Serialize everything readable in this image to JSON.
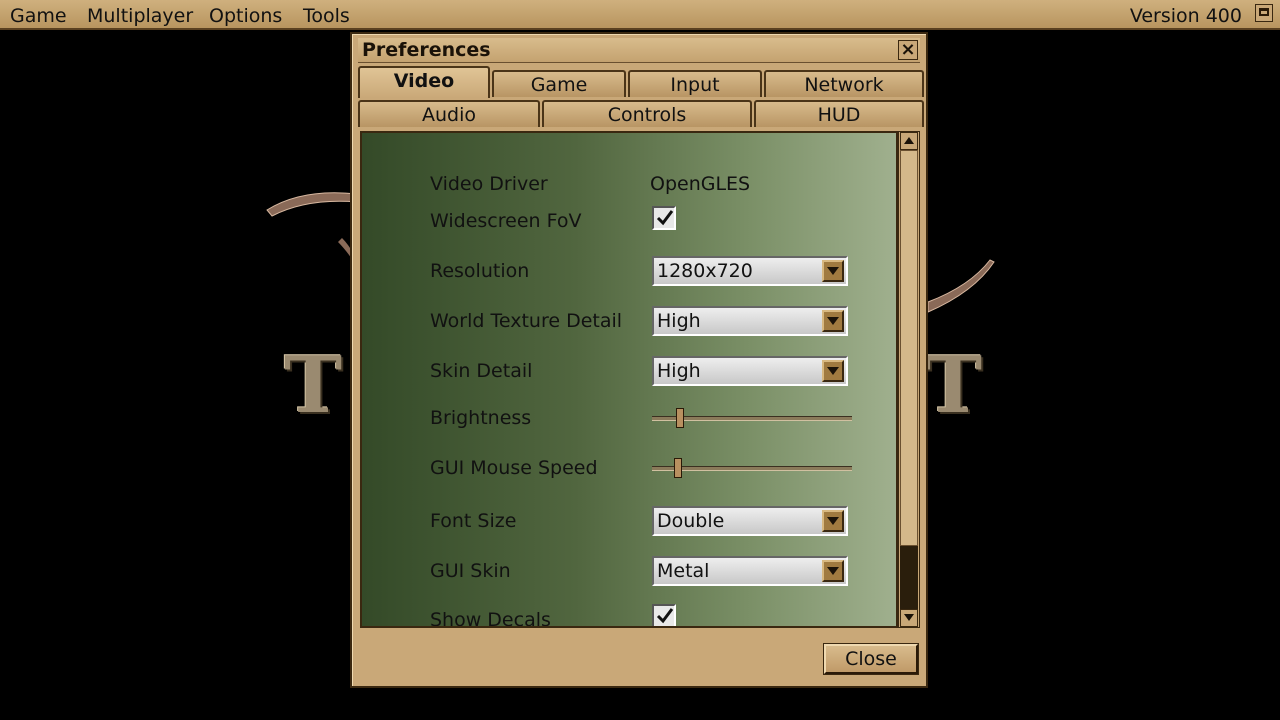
{
  "menubar": {
    "items": [
      "Game",
      "Multiplayer",
      "Options",
      "Tools"
    ],
    "version": "Version 400"
  },
  "background_logo": {
    "letter_left": "T",
    "letter_right": "T"
  },
  "dialog": {
    "title": "Preferences",
    "close_x": "×",
    "tabs_row1": [
      "Video",
      "Game",
      "Input",
      "Network"
    ],
    "tabs_row2": [
      "Audio",
      "Controls",
      "HUD"
    ],
    "active_tab": "Video",
    "close_button": "Close"
  },
  "settings": {
    "video_driver": {
      "label": "Video Driver",
      "value": "OpenGLES"
    },
    "widescreen_fov": {
      "label": "Widescreen FoV",
      "checked": true
    },
    "resolution": {
      "label": "Resolution",
      "value": "1280x720"
    },
    "world_texture_detail": {
      "label": "World Texture Detail",
      "value": "High"
    },
    "skin_detail": {
      "label": "Skin Detail",
      "value": "High"
    },
    "brightness": {
      "label": "Brightness",
      "level": 0.14
    },
    "gui_mouse_speed": {
      "label": "GUI Mouse Speed",
      "level": 0.13
    },
    "font_size": {
      "label": "Font Size",
      "value": "Double"
    },
    "gui_skin": {
      "label": "GUI Skin",
      "value": "Metal"
    },
    "show_decals": {
      "label": "Show Decals",
      "checked": true
    }
  },
  "colors": {
    "ui_tan": "#c9a878",
    "content_gradient_left": "#344a28",
    "content_gradient_right": "#a0b08e"
  }
}
